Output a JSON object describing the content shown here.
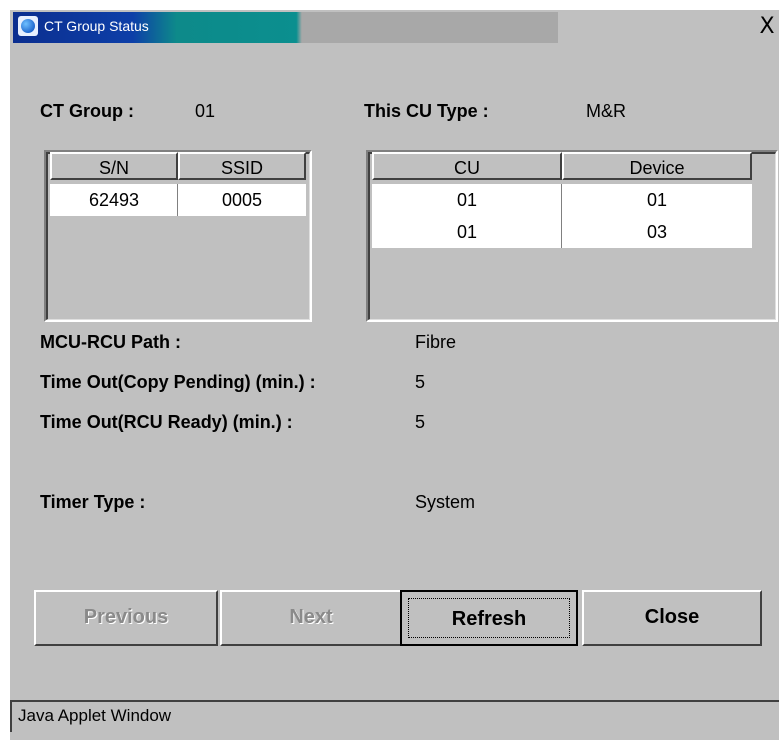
{
  "window": {
    "title": "CT Group Status",
    "close_symbol": "X",
    "status_text": "Java Applet Window"
  },
  "labels": {
    "ct_group": "CT Group :",
    "ct_group_value": "01",
    "cu_type": "This CU Type :",
    "cu_type_value": "M&R",
    "path": "MCU-RCU Path :",
    "path_value": "Fibre",
    "timeout_copy": "Time Out(Copy Pending) (min.) :",
    "timeout_copy_value": "5",
    "timeout_rcu": "Time Out(RCU Ready) (min.) :",
    "timeout_rcu_value": "5",
    "timer_type": "Timer Type :",
    "timer_type_value": "System"
  },
  "sn_table": {
    "headers": [
      "S/N",
      "SSID"
    ],
    "rows": [
      [
        "62493",
        "0005"
      ]
    ]
  },
  "cu_table": {
    "headers": [
      "CU",
      "Device"
    ],
    "rows": [
      [
        "01",
        "01"
      ],
      [
        "01",
        "03"
      ]
    ]
  },
  "buttons": {
    "previous": "Previous",
    "next": "Next",
    "refresh": "Refresh",
    "close": "Close"
  },
  "icons": {
    "title_icon": "ie-applet-icon",
    "close_icon": "close-icon"
  }
}
